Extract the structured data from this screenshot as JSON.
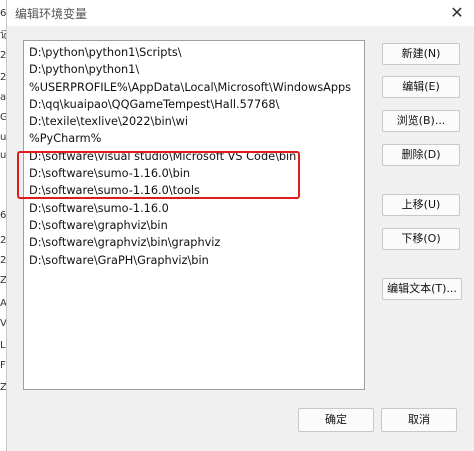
{
  "window": {
    "title": "编辑环境变量",
    "close_glyph": "✕"
  },
  "background_chars": [
    "6",
    "记",
    "2",
    "2",
    "a",
    "G",
    "u",
    "u",
    "6",
    "2",
    "2",
    "Z",
    "A",
    "V",
    "L",
    "F",
    "Z"
  ],
  "paths": [
    "D:\\python\\python1\\Scripts\\",
    "D:\\python\\python1\\",
    "%USERPROFILE%\\AppData\\Local\\Microsoft\\WindowsApps",
    "D:\\qq\\kuaipao\\QQGameTempest\\Hall.57768\\",
    "D:\\texile\\texlive\\2022\\bin\\wi",
    "%PyCharm%",
    "D:\\software\\visual studio\\Microsoft VS Code\\bin",
    "D:\\software\\sumo-1.16.0\\bin",
    "D:\\software\\sumo-1.16.0\\tools",
    "D:\\software\\sumo-1.16.0",
    "D:\\software\\graphviz\\bin",
    "D:\\software\\graphviz\\bin\\graphviz",
    "D:\\software\\GraPH\\Graphviz\\bin"
  ],
  "buttons": {
    "new": "新建(N)",
    "edit": "编辑(E)",
    "browse": "浏览(B)...",
    "delete": "删除(D)",
    "move_up": "上移(U)",
    "move_down": "下移(O)",
    "edit_text": "编辑文本(T)...",
    "ok": "确定",
    "cancel": "取消"
  },
  "colors": {
    "highlight_border": "#e11a1a"
  }
}
